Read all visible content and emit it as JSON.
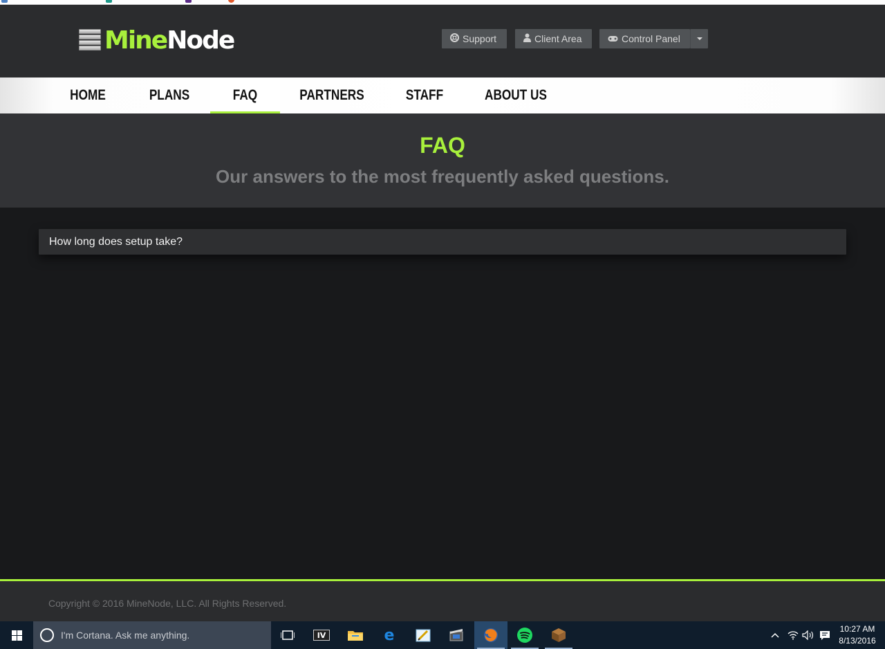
{
  "header": {
    "logo": {
      "mine": "Mine",
      "node": "Node"
    },
    "buttons": {
      "support": "Support",
      "client_area": "Client Area",
      "control_panel": "Control Panel"
    }
  },
  "nav": {
    "items": [
      "HOME",
      "PLANS",
      "FAQ",
      "PARTNERS",
      "STAFF",
      "ABOUT US"
    ],
    "active": "FAQ"
  },
  "hero": {
    "title": "FAQ",
    "subtitle": "Our answers to the most frequently asked questions."
  },
  "faq": {
    "items": [
      {
        "question": "How long does setup take?"
      }
    ]
  },
  "footer": {
    "copyright": "Copyright © 2016 MineNode, LLC. All Rights Reserved."
  },
  "taskbar": {
    "search_placeholder": "I'm Cortana. Ask me anything.",
    "pinned_icons": [
      "task-view-icon",
      "iv-app-icon",
      "file-explorer-icon",
      "edge-icon",
      "paint-icon",
      "video-editor-icon",
      "firefox-icon",
      "spotify-icon",
      "minecraft-icon"
    ],
    "clock": {
      "time": "10:27 AM",
      "date": "8/13/2016"
    }
  },
  "colors": {
    "accent": "#a8f03c",
    "header_bg": "#2b2c2e",
    "hero_bg": "#323336",
    "body_bg": "#18191b"
  }
}
